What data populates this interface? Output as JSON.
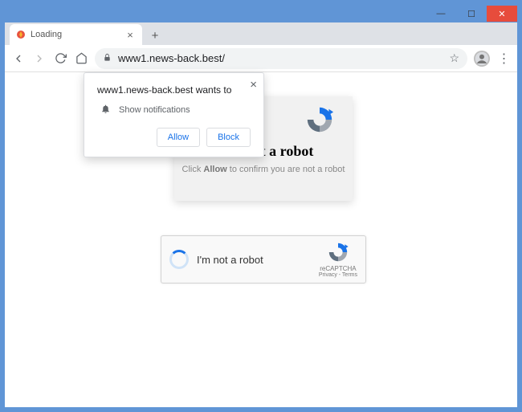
{
  "window": {
    "minimize": "—",
    "maximize": "☐",
    "close": "✕"
  },
  "tab": {
    "title": "Loading",
    "close": "×"
  },
  "newtab": "+",
  "toolbar": {
    "back": "←",
    "forward": "→",
    "reload": "⟳",
    "home": "⌂",
    "lock": "🔒",
    "url": "www1.news-back.best/",
    "star": "☆",
    "menu": "⋮"
  },
  "perm": {
    "title": "www1.news-back.best wants to",
    "notif_label": "Show notifications",
    "bell": "🔔",
    "allow": "Allow",
    "block": "Block",
    "close": "×"
  },
  "captcha_card": {
    "heading": "I am not a robot",
    "sub_pre": "Click ",
    "sub_b": "Allow",
    "sub_post": " to confirm you are not a robot"
  },
  "recaptcha": {
    "text": "I'm not a robot",
    "label": "reCAPTCHA",
    "links": "Privacy - Terms"
  }
}
